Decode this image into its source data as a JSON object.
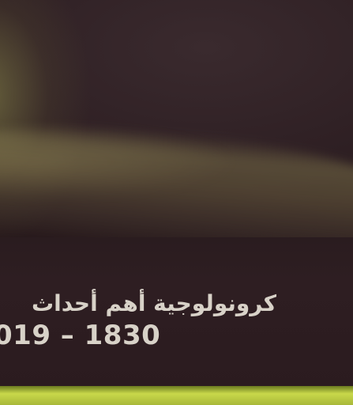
{
  "caption": {
    "title": "كرونولوجية أهم أحداث",
    "years": "019 – 1830"
  },
  "colors": {
    "background": "#2a1a1c",
    "text": "#d8d2c8",
    "strip": "#c9d84a"
  }
}
